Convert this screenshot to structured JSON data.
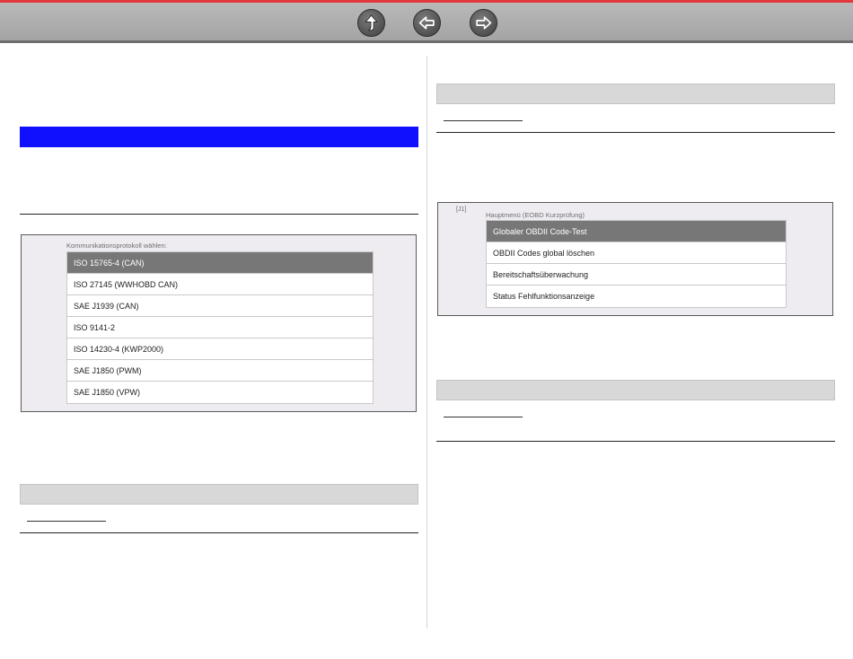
{
  "toolbar": {
    "icons": [
      "up-arrow-icon",
      "left-arrow-icon",
      "right-arrow-icon"
    ]
  },
  "protocol_panel": {
    "caption": "Kommunikationsprotokoll wählen:",
    "items": [
      {
        "label": "ISO 15765-4 (CAN)",
        "selected": true
      },
      {
        "label": "ISO 27145 (WWHOBD CAN)",
        "selected": false
      },
      {
        "label": "SAE J1939 (CAN)",
        "selected": false
      },
      {
        "label": "ISO 9141-2",
        "selected": false
      },
      {
        "label": "ISO 14230-4 (KWP2000)",
        "selected": false
      },
      {
        "label": "SAE J1850 (PWM)",
        "selected": false
      },
      {
        "label": "SAE J1850 (VPW)",
        "selected": false
      }
    ]
  },
  "menu_panel": {
    "tag": "[J1]",
    "caption": "Hauptmenü (EOBD Kurzprüfung)",
    "items": [
      {
        "label": "Globaler OBDII Code-Test",
        "selected": true
      },
      {
        "label": "OBDII Codes global löschen",
        "selected": false
      },
      {
        "label": "Bereitschaftsüberwachung",
        "selected": false
      },
      {
        "label": "Status Fehlfunktionsanzeige",
        "selected": false
      }
    ]
  },
  "colors": {
    "accent_red": "#e03a3e",
    "highlight_blue": "#1010ff",
    "selected_row": "#777777"
  }
}
